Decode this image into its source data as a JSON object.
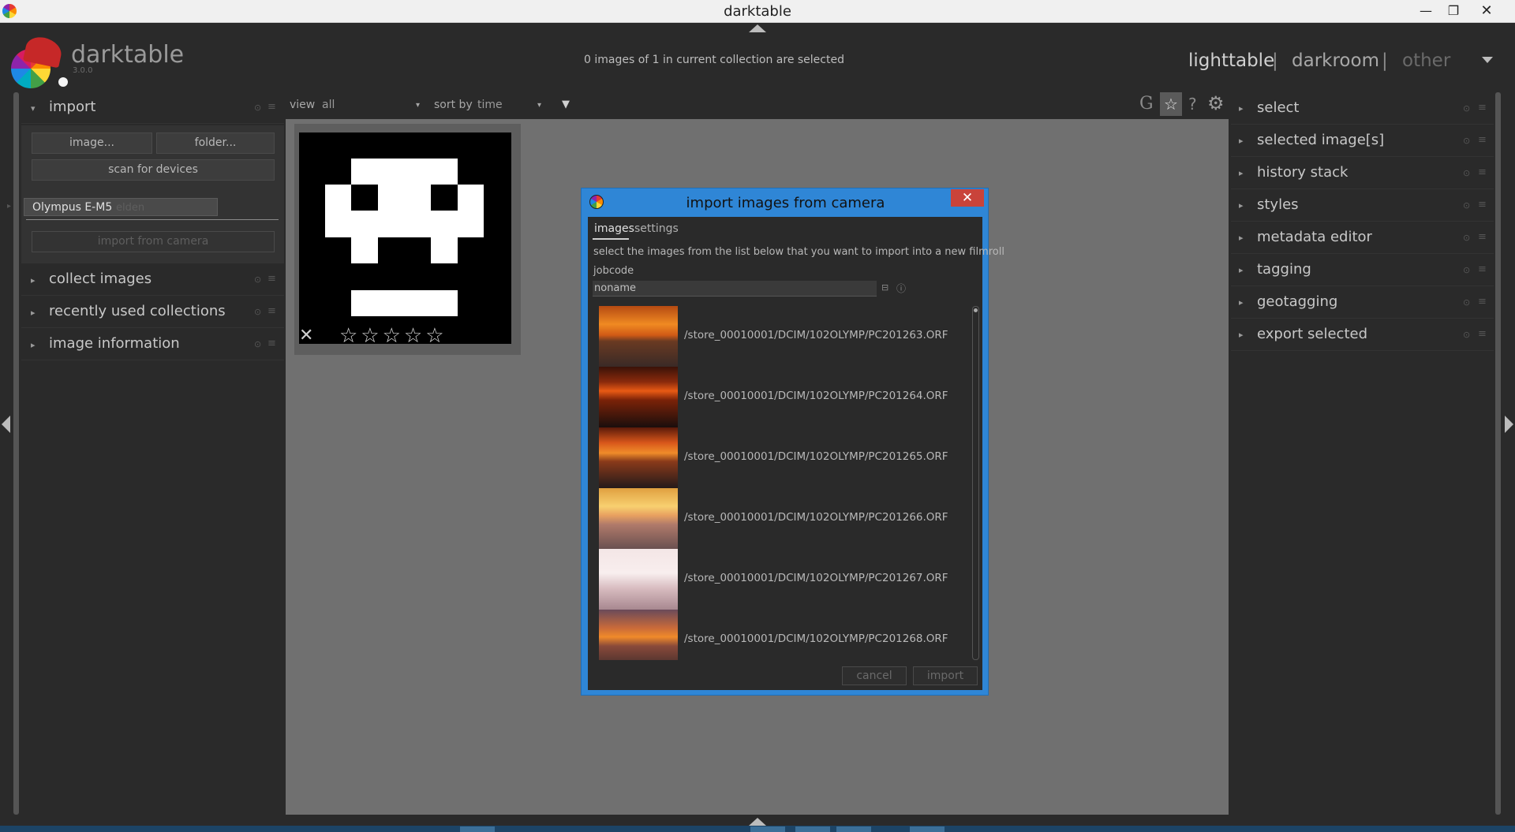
{
  "window": {
    "title": "darktable",
    "minimize": "—",
    "maximize": "❐",
    "close": "✕"
  },
  "header": {
    "brand": "darktable",
    "version": "3.0.0",
    "collection_info": "0 images of 1 in current collection are selected",
    "views": {
      "lighttable": "lighttable",
      "separator": "|",
      "darkroom": "darkroom",
      "other": "other"
    }
  },
  "left_panel": {
    "import": {
      "label": "import",
      "buttons": {
        "image": "image...",
        "folder": "folder...",
        "scan": "scan for devices"
      },
      "device": {
        "name": "Olympus E-M5",
        "ghost": "elden"
      },
      "import_from_camera": "import from camera"
    },
    "modules": [
      {
        "label": "collect images"
      },
      {
        "label": "recently used collections"
      },
      {
        "label": "image information"
      }
    ],
    "icons": {
      "collapsed": "▸",
      "expanded": "▾",
      "reset": "⊙",
      "presets": "≡"
    }
  },
  "toolbar": {
    "view_label": "view",
    "view_value": "all",
    "sort_label": "sort by",
    "sort_value": "time",
    "dropdown": "▾",
    "sort_direction": "▼",
    "grouping": "G",
    "star": "☆",
    "help": "?",
    "gear": "⚙"
  },
  "thumbnail": {
    "reject": "✕",
    "stars": "☆☆☆☆☆"
  },
  "dialog": {
    "title": "import images from camera",
    "close": "✕",
    "tabs": {
      "images": "images",
      "settings": "settings"
    },
    "description": "select the images from the list below that you want to import into a new filmroll",
    "jobcode_label": "jobcode",
    "jobcode_value": "noname",
    "field_icon_a": "⊟",
    "field_icon_b": "ⓘ",
    "rows": [
      {
        "path": "/store_00010001/DCIM/102OLYMP/PC201263.ORF"
      },
      {
        "path": "/store_00010001/DCIM/102OLYMP/PC201264.ORF"
      },
      {
        "path": "/store_00010001/DCIM/102OLYMP/PC201265.ORF"
      },
      {
        "path": "/store_00010001/DCIM/102OLYMP/PC201266.ORF"
      },
      {
        "path": "/store_00010001/DCIM/102OLYMP/PC201267.ORF"
      },
      {
        "path": "/store_00010001/DCIM/102OLYMP/PC201268.ORF"
      }
    ],
    "cancel": "cancel",
    "import": "import"
  },
  "right_panel": {
    "modules": [
      {
        "label": "select"
      },
      {
        "label": "selected image[s]"
      },
      {
        "label": "history stack"
      },
      {
        "label": "styles"
      },
      {
        "label": "metadata editor"
      },
      {
        "label": "tagging"
      },
      {
        "label": "geotagging"
      },
      {
        "label": "export selected"
      }
    ]
  },
  "colors": {
    "dialog_border": "#2f86d6",
    "dialog_close": "#c9433a",
    "panel_bg": "#2a2a2a",
    "center_bg": "#707070"
  }
}
